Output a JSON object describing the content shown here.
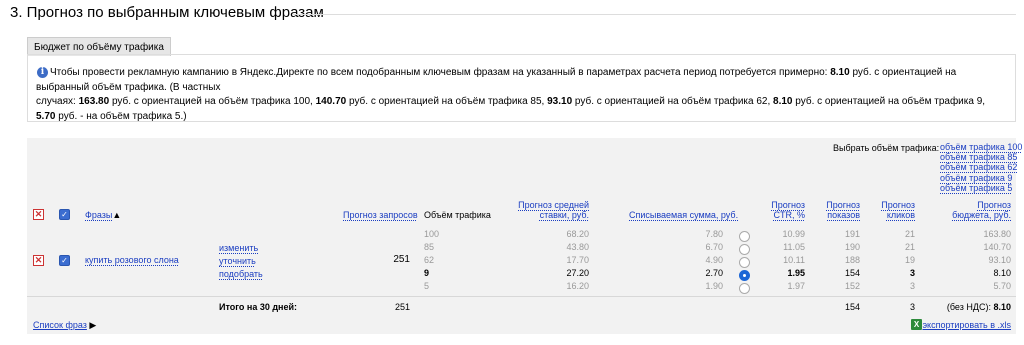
{
  "section_title": "3. Прогноз по выбранным ключевым фразам",
  "tab_label": "Бюджет по объёму трафика",
  "info": {
    "line1": "Чтобы провести рекламную кампанию в Яндекс.Директе по всем подобранным ключевым фразам на указанный в параметрах расчета период потребуется примерно: 8.10 руб. с ориентацией на выбранный объём трафика. (В частных",
    "line2": "случаях: 163.80 руб. с ориентацией на объём трафика 100, 140.70 руб. с ориентацией на объём трафика 85, 93.10 руб. с ориентацией на объём трафика 62, 8.10 руб. с ориентацией на объём трафика 9, 5.70 руб. - на объём трафика 5.)"
  },
  "traffic_select": {
    "label": "Выбрать объём трафика:",
    "options": [
      "объём трафика 100",
      "объём трафика 85",
      "объём трафика 62",
      "объём трафика 9",
      "объём трафика 5"
    ]
  },
  "headers": {
    "phrases": "Фразы",
    "phrases_sort": "▲",
    "requests": "Прогноз запросов",
    "traffic": "Объём трафика",
    "bid": [
      "Прогноз средней",
      "ставки, руб."
    ],
    "charged": "Списываемая сумма, руб.",
    "ctr": [
      "Прогноз",
      "CTR, %"
    ],
    "shows": [
      "Прогноз",
      "показов"
    ],
    "clicks": [
      "Прогноз",
      "кликов"
    ],
    "budget": [
      "Прогноз",
      "бюджета, руб."
    ]
  },
  "phrase": {
    "text": "купить розового слона",
    "actions": [
      "изменить",
      "уточнить",
      "подобрать"
    ],
    "requests": "251"
  },
  "rows": [
    {
      "traffic": "100",
      "bid": "68.20",
      "charged": "7.80",
      "ctr": "10.99",
      "shows": "191",
      "clicks": "21",
      "budget": "163.80",
      "selected": false
    },
    {
      "traffic": "85",
      "bid": "43.80",
      "charged": "6.70",
      "ctr": "11.05",
      "shows": "190",
      "clicks": "21",
      "budget": "140.70",
      "selected": false
    },
    {
      "traffic": "62",
      "bid": "17.70",
      "charged": "4.90",
      "ctr": "10.11",
      "shows": "188",
      "clicks": "19",
      "budget": "93.10",
      "selected": false
    },
    {
      "traffic": "9",
      "bid": "27.20",
      "charged": "2.70",
      "ctr": "1.95",
      "shows": "154",
      "clicks": "3",
      "budget": "8.10",
      "selected": true
    },
    {
      "traffic": "5",
      "bid": "16.20",
      "charged": "1.90",
      "ctr": "1.97",
      "shows": "152",
      "clicks": "3",
      "budget": "5.70",
      "selected": false
    }
  ],
  "totals": {
    "label": "Итого на 30 дней:",
    "requests": "251",
    "shows": "154",
    "clicks": "3",
    "budget_label": "(без НДС):",
    "budget": "8.10"
  },
  "footer": {
    "phrase_list": "Список фраз",
    "phrase_list_arrow": "▶",
    "export": "экспортировать в .xls"
  }
}
